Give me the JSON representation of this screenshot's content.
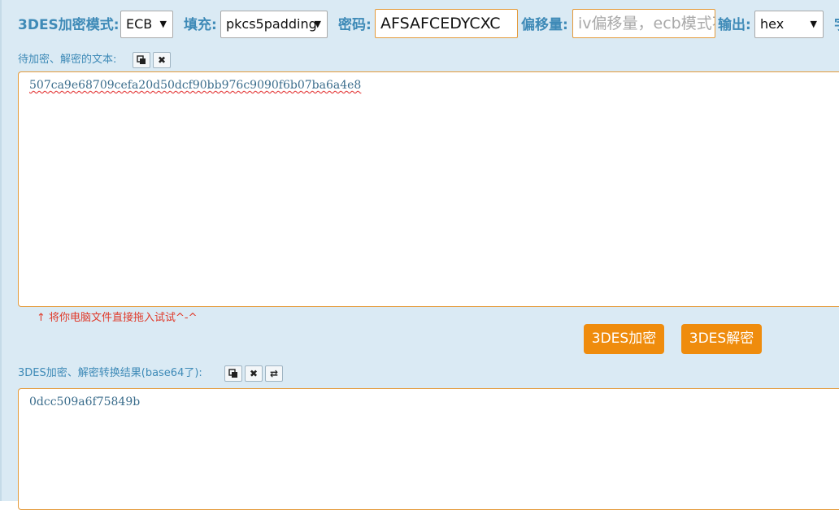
{
  "toolbar": {
    "mode_label": "3DES加密模式:",
    "mode_value": "ECB",
    "padding_label": "填充:",
    "padding_value": "pkcs5padding",
    "key_label": "密码:",
    "key_value": "AFSAFCEDYCXC",
    "iv_label": "偏移量:",
    "iv_placeholder": "iv偏移量，ecb模式不用填写",
    "output_label": "输出:",
    "output_value": "hex",
    "overflow_glyph": "字"
  },
  "input_section": {
    "label": "待加密、解密的文本:",
    "copy_icon": "copy-icon",
    "clear_icon": "clear-icon",
    "text": "507ca9e68709cefa20d50dcf90bb976c9090f6b07ba6a4e8",
    "drop_hint": "↑ 将你电脑文件直接拖入试试^-^"
  },
  "actions": {
    "encrypt_label": "3DES加密",
    "decrypt_label": "3DES解密"
  },
  "result_section": {
    "label": "3DES加密、解密转换结果(base64了):",
    "copy_icon": "copy-icon",
    "clear_icon": "clear-icon",
    "swap_icon": "swap-icon",
    "text": "0dcc509a6f75849b"
  },
  "colors": {
    "panel_bg": "#daeaf4",
    "label_blue": "#3e8ab7",
    "accent_orange": "#ef8c0d",
    "hint_red": "#e03a2a"
  }
}
